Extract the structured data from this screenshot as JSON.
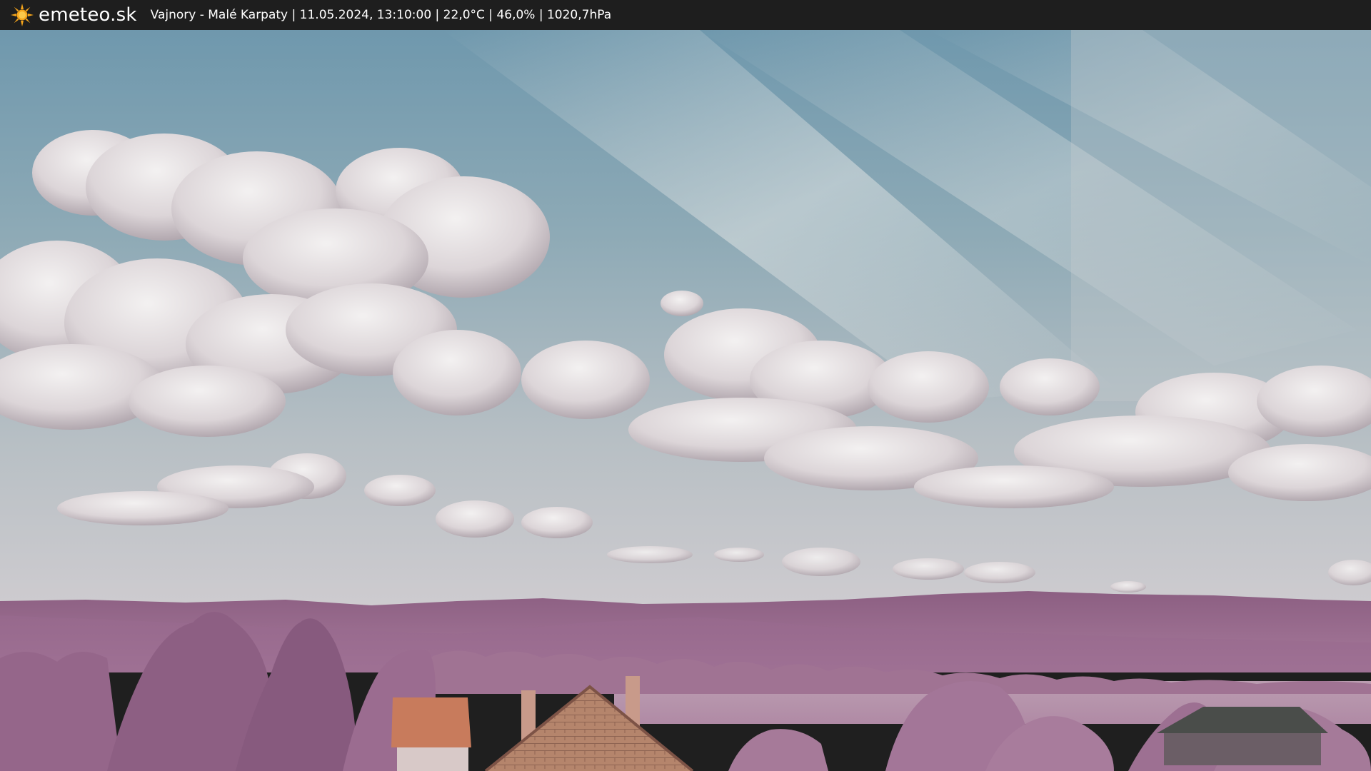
{
  "header": {
    "logo_text": "emeteo.sk",
    "logo_icon": "sun-icon",
    "status": "Vajnory - Malé Karpaty | 11.05.2024, 13:10:00 | 22,0°C | 46,0% | 1020,7hPa"
  },
  "colors": {
    "bar_background": "#1e1e1e",
    "sun": "#f6a51b",
    "sky_top": "#6f98ad",
    "foliage": "#a46f94"
  }
}
